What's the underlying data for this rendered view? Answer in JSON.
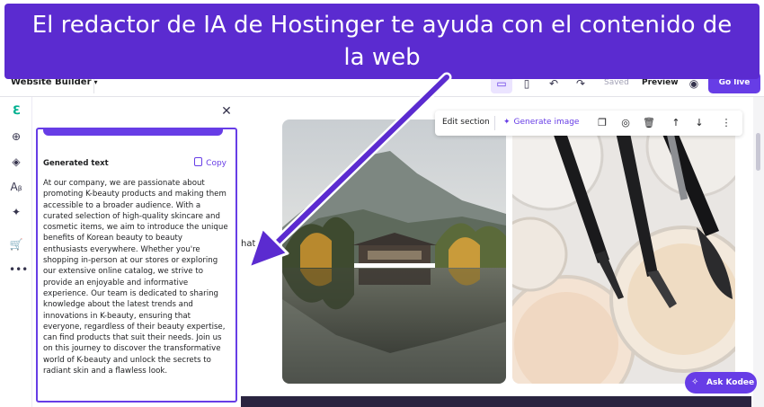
{
  "banner": {
    "text": "El redactor de IA de Hostinger te ayuda con el contenido de la web"
  },
  "topbar": {
    "builder_label": "Website Builder",
    "saved_label": "Saved",
    "preview_label": "Preview",
    "go_live_label": "Go live"
  },
  "rail": {
    "items": [
      "logo-icon",
      "add-icon",
      "layers-icon",
      "styles-icon",
      "ai-icon",
      "store-icon",
      "more-icon"
    ]
  },
  "ai_panel": {
    "generated_title": "Generated text",
    "copy_label": "Copy",
    "generated_text": "At our company, we are passionate about promoting K-beauty products and making them accessible to a broader audience. With a curated selection of high-quality skincare and cosmetic items, we aim to introduce the unique benefits of Korean beauty to beauty enthusiasts everywhere. Whether you're shopping in-person at our stores or exploring our extensive online catalog, we strive to provide an enjoyable and informative experience. Our team is dedicated to sharing knowledge about the latest trends and innovations in K-beauty, ensuring that everyone, regardless of their beauty expertise, can find products that suit their needs. Join us on this journey to discover the transformative world of K-beauty and unlock the secrets to radiant skin and a flawless look."
  },
  "canvas": {
    "partial_text": "hat"
  },
  "edit_toolbar": {
    "edit_section_label": "Edit section",
    "generate_image_label": "Generate image"
  },
  "kodee": {
    "label": "Ask Kodee"
  },
  "colors": {
    "accent": "#673de6",
    "banner": "#5b2bd0"
  }
}
